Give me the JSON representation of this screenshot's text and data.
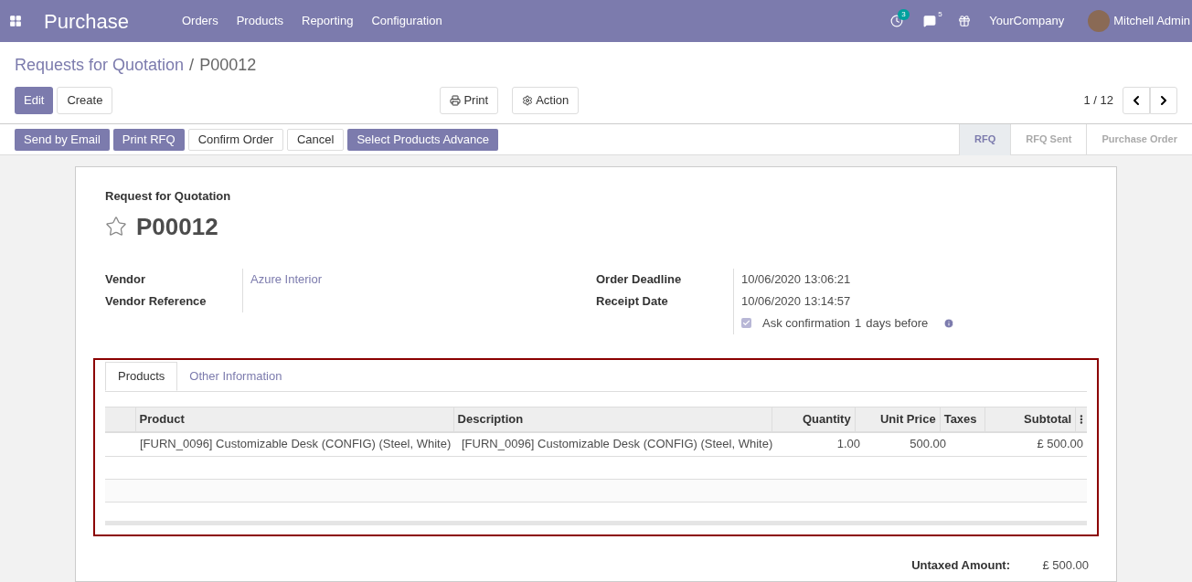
{
  "navbar": {
    "app_title": "Purchase",
    "menu": [
      "Orders",
      "Products",
      "Reporting",
      "Configuration"
    ],
    "activity_count": "3",
    "message_count": "5",
    "company": "YourCompany",
    "user": "Mitchell Admin"
  },
  "breadcrumb": {
    "parent": "Requests for Quotation",
    "separator": "/",
    "current": "P00012"
  },
  "control_panel": {
    "edit": "Edit",
    "create": "Create",
    "print": "Print",
    "action": "Action",
    "pager": "1 / 12"
  },
  "status_buttons": [
    {
      "label": "Send by Email",
      "kind": "primary"
    },
    {
      "label": "Print RFQ",
      "kind": "primary"
    },
    {
      "label": "Confirm Order",
      "kind": "secondary"
    },
    {
      "label": "Cancel",
      "kind": "secondary"
    },
    {
      "label": "Select Products Advance",
      "kind": "primary"
    }
  ],
  "stages": [
    {
      "label": "RFQ",
      "selected": true
    },
    {
      "label": "RFQ Sent",
      "selected": false
    },
    {
      "label": "Purchase Order",
      "selected": false
    }
  ],
  "form": {
    "subtitle": "Request for Quotation",
    "name": "P00012",
    "starred": false,
    "left_fields": [
      {
        "label": "Vendor",
        "value": "Azure Interior",
        "kind": "link"
      },
      {
        "label": "Vendor Reference",
        "kind": "text"
      }
    ],
    "right_fields": [
      {
        "label": "Order Deadline",
        "value": "10/06/2020 13:06:21"
      },
      {
        "label": "Receipt Date",
        "value": "10/06/2020 13:14:57"
      }
    ],
    "ask_confirmation": {
      "checked": true,
      "label": "Ask confirmation",
      "days": "1",
      "suffix": "days before"
    }
  },
  "tabs": [
    {
      "label": "Products",
      "selected": true
    },
    {
      "label": "Other Information",
      "selected": false
    }
  ],
  "table": {
    "columns": [
      {
        "label": "Product",
        "kind": "text"
      },
      {
        "label": "Description",
        "kind": "text"
      },
      {
        "label": "Quantity",
        "kind": "number"
      },
      {
        "label": "Unit Price",
        "kind": "number"
      },
      {
        "label": "Taxes",
        "kind": "text"
      },
      {
        "label": "Subtotal",
        "kind": "number"
      }
    ],
    "rows": [
      [
        "[FURN_0096] Customizable Desk (CONFIG) (Steel, White)",
        "[FURN_0096] Customizable Desk (CONFIG) (Steel, White)",
        "1.00",
        "500.00",
        "",
        "£ 500.00"
      ]
    ]
  },
  "totals": [
    {
      "label": "Untaxed Amount:",
      "value": "£ 500.00"
    }
  ]
}
